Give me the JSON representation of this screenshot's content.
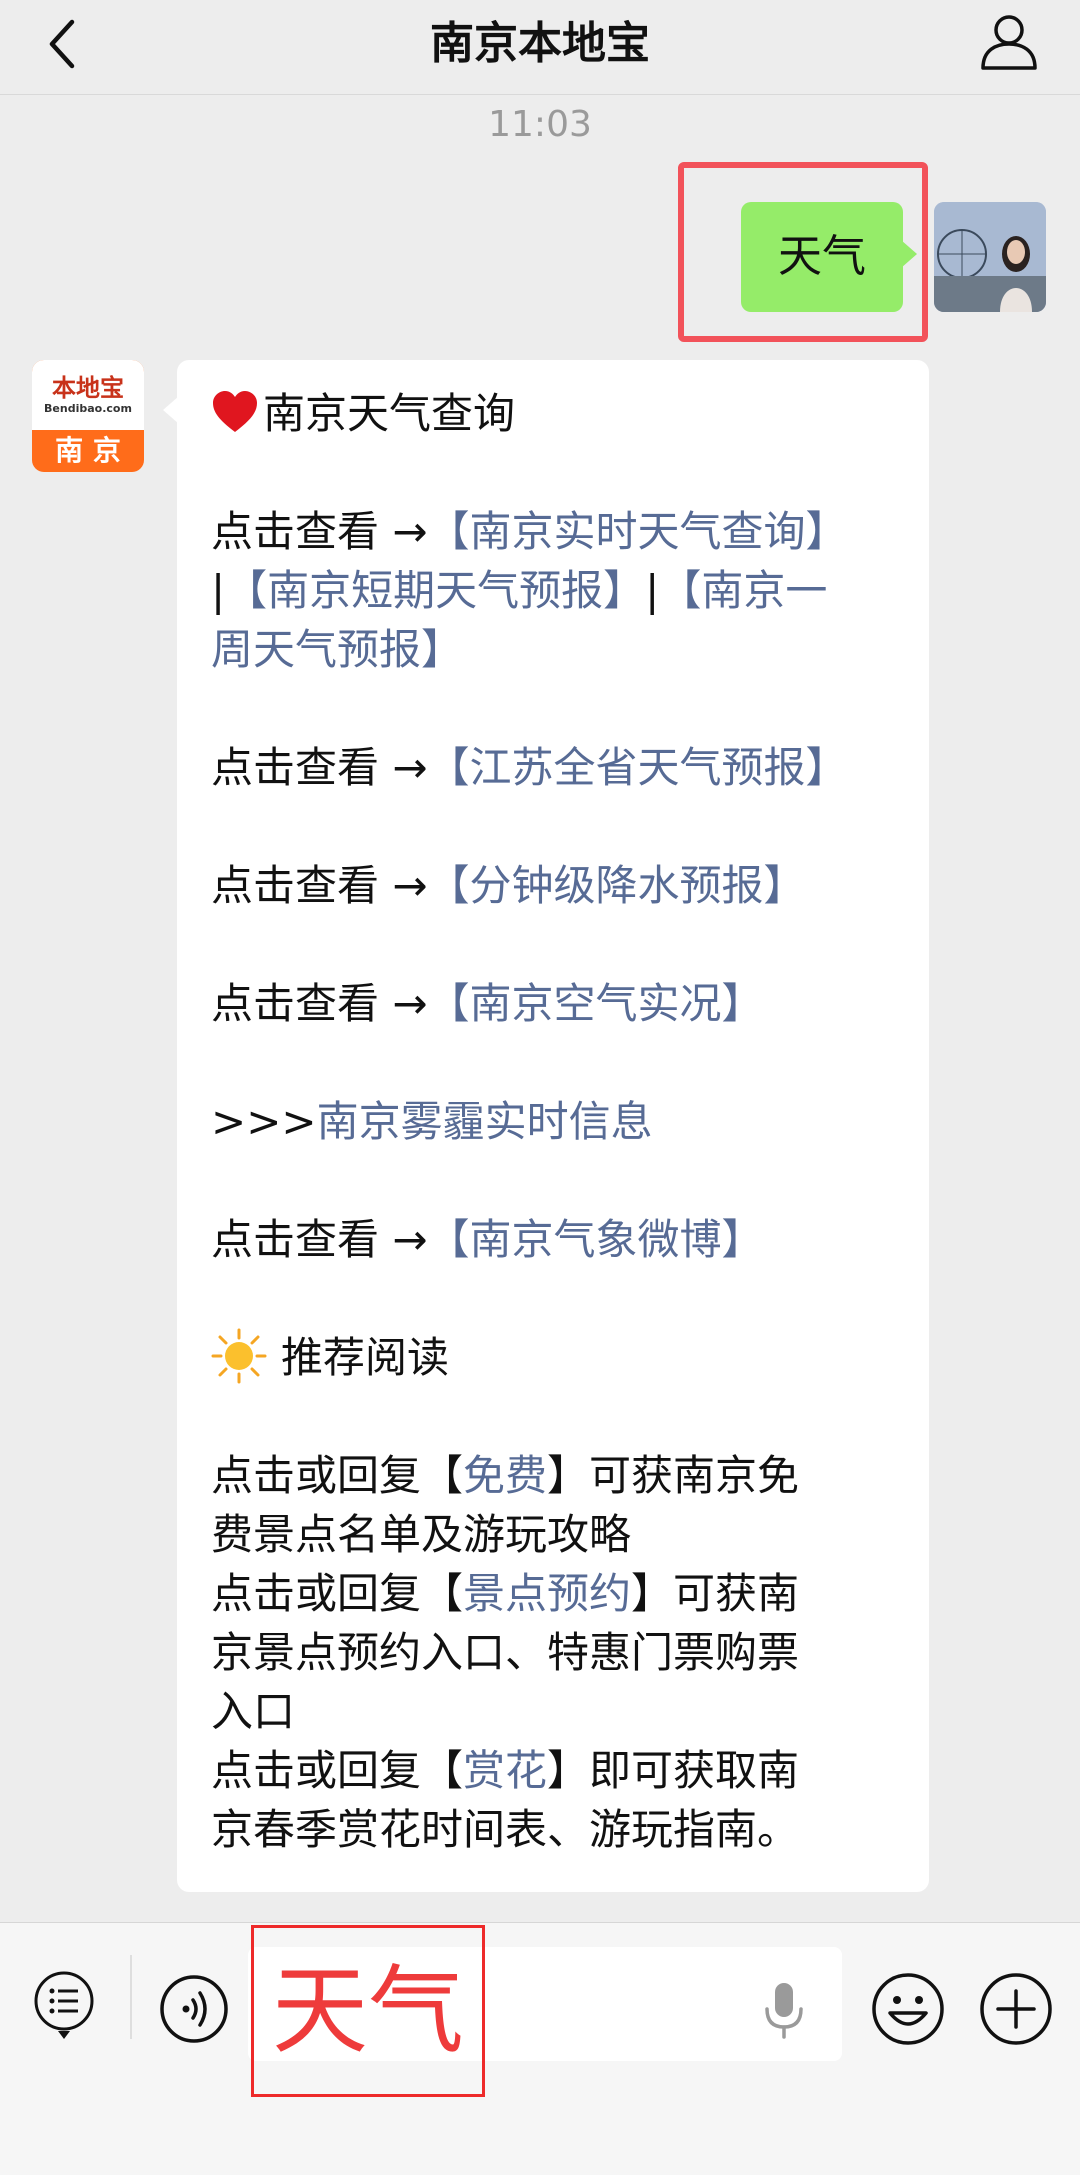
{
  "header": {
    "title": "南京本地宝"
  },
  "chat": {
    "time": "11:03",
    "outgoing_text": "天气",
    "brand_avatar": {
      "name": "本地宝",
      "url": "Bendibao.com",
      "city": "南 京"
    },
    "incoming": {
      "heading": "南京天气查询",
      "prefix_view": "点击查看 →",
      "link_realtime": "【南京实时天气查询】",
      "sep1": "|",
      "link_short": "【南京短期天气预报】",
      "sep2": "|",
      "link_week_a": "【南京一",
      "link_week_b": "周天气预报】",
      "prefix_view2": "点击查看 →",
      "link_jiangsu": "【江苏全省天气预报】",
      "prefix_view3": "点击查看 →",
      "link_rain": "【分钟级降水预报】",
      "prefix_view4": "点击查看 →",
      "link_air": "【南京空气实况】",
      "arrows": ">>>",
      "link_haze": "南京雾霾实时信息",
      "prefix_view5": "点击查看 →",
      "link_weibo": "【南京气象微博】",
      "recommend": "推荐阅读",
      "r1_a": "点击或回复【",
      "r1_link": "免费",
      "r1_b": "】可获南京免",
      "r1_c": "费景点名单及游玩攻略",
      "r2_a": "点击或回复【",
      "r2_link": "景点预约",
      "r2_b": "】可获南",
      "r2_c": "京景点预约入口、特惠门票购票",
      "r2_d": "入口",
      "r3_a": "点击或回复【",
      "r3_link": "赏花",
      "r3_b": "】即可获取南",
      "r3_c": "京春季赏花时间表、游玩指南。"
    }
  },
  "composer": {
    "typed_text": "天气"
  },
  "colors": {
    "link": "#576b95",
    "bubble_out": "#95ec69",
    "highlight_red": "#f2525a"
  }
}
